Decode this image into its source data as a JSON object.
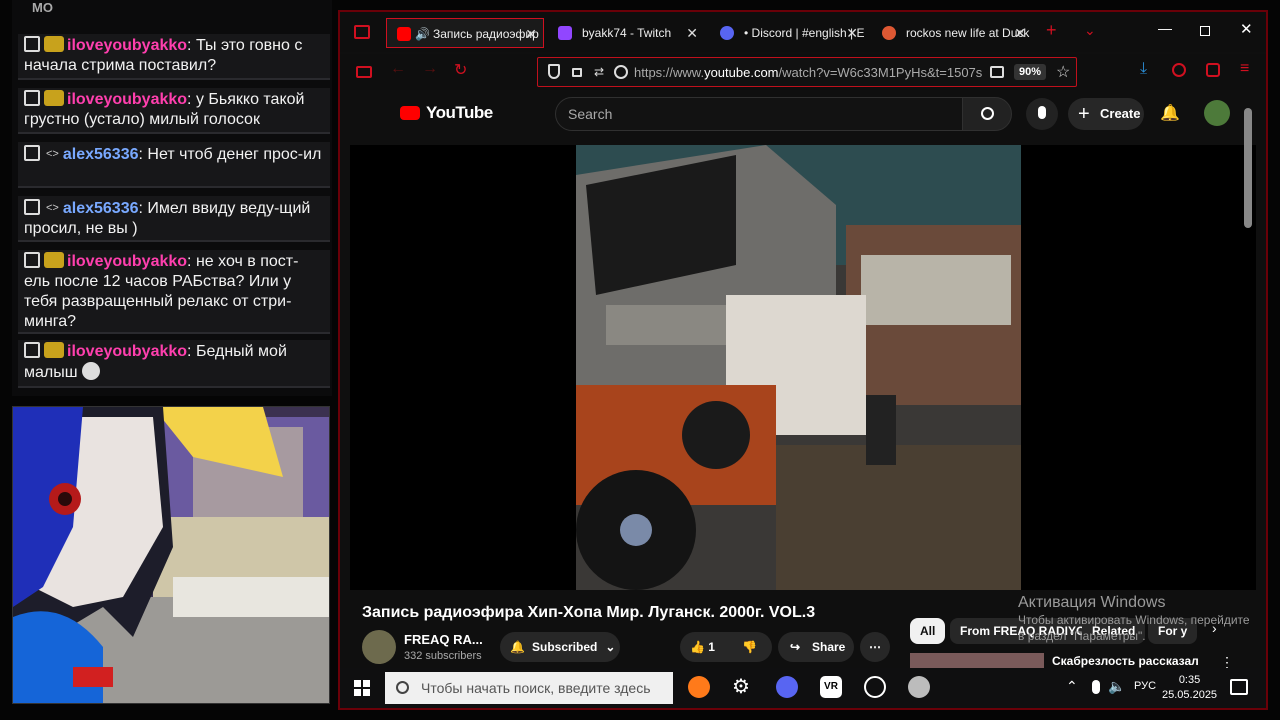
{
  "chat": {
    "header": "MO",
    "messages": [
      {
        "user": "iloveyoubyakko",
        "text": "Ты это говно с начала стрима поставил?"
      },
      {
        "user": "iloveyoubyakko",
        "text": "у Бьякко такой грустно (устало) милый голосок"
      },
      {
        "user": "alex56336",
        "text": "Нет чтоб денег прос-ил"
      },
      {
        "user": "alex56336",
        "text": "Имел ввиду веду-щий просил, не вы )"
      },
      {
        "user": "iloveyoubyakko",
        "text": "не хоч в пост-ель после 12 часов РАБства? Или у тебя развращенный релакс от стри-минга?"
      },
      {
        "user": "iloveyoubyakko",
        "text": "Бедный мой малыш"
      }
    ]
  },
  "browser": {
    "tabs": [
      {
        "label": "Запись радиоэфир",
        "icon": "youtube-icon",
        "color": "#ff0000"
      },
      {
        "label": "byakk74 - Twitch",
        "icon": "twitch-icon",
        "color": "#9146ff"
      },
      {
        "label": "• Discord | #english | Er",
        "icon": "discord-icon",
        "color": "#5865f2"
      },
      {
        "label": "rockos new life at Duck",
        "icon": "duckduckgo-icon",
        "color": "#de5833"
      }
    ],
    "url_prefix": "https://www.",
    "url_host": "youtube.com",
    "url_rest": "/watch?v=W6c33M1PyHs&t=1507s",
    "zoom": "90%"
  },
  "youtube": {
    "logo": "YouTube",
    "search_placeholder": "Search",
    "create_label": "Create",
    "video_title": "Запись радиоэфира Хип-Хопа Мир. Луганск. 2000г. VOL.3",
    "channel_name": "FREAQ RA...",
    "subscribers": "332 subscribers",
    "subscribed_label": "Subscribed",
    "likes": "1",
    "share_label": "Share",
    "chips": [
      "All",
      "From FREAQ RADIYO",
      "Related",
      "For y"
    ],
    "related_title": "Скабрезлость рассказал о своих Родителях"
  },
  "activation": {
    "title": "Активация Windows",
    "subtitle": "Чтобы активировать Windows, перейдите в раздел \"Параметры\"."
  },
  "taskbar": {
    "search_placeholder": "Чтобы начать поиск, введите здесь",
    "lang": "РУС",
    "time": "0:35",
    "date": "25.05.2025"
  }
}
